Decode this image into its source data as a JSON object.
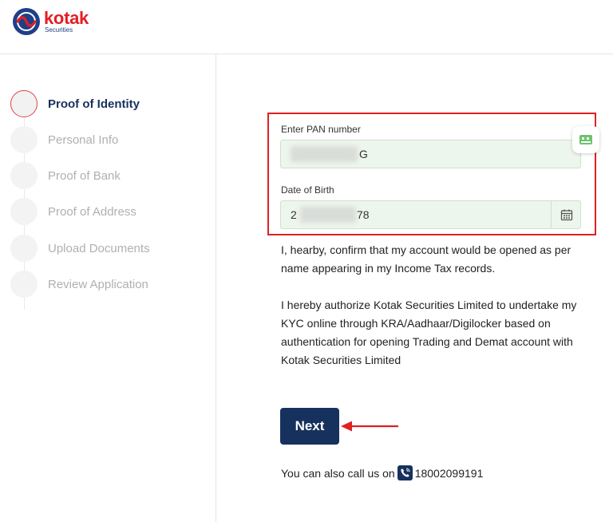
{
  "brand": {
    "name": "kotak",
    "subtitle": "Securities",
    "colors": {
      "red": "#e31e24",
      "navy": "#17315e"
    }
  },
  "steps": [
    {
      "label": "Proof of Identity",
      "active": true
    },
    {
      "label": "Personal Info",
      "active": false
    },
    {
      "label": "Proof of Bank",
      "active": false
    },
    {
      "label": "Proof of Address",
      "active": false
    },
    {
      "label": "Upload Documents",
      "active": false
    },
    {
      "label": "Review Application",
      "active": false
    }
  ],
  "form": {
    "pan": {
      "label": "Enter PAN number",
      "value_visible": "G"
    },
    "dob": {
      "label": "Date of Birth",
      "value_start": "2",
      "value_end": "78"
    }
  },
  "consent": {
    "confirm_text": "I, hearby, confirm that my account would be opened as per name appearing in my Income Tax records.",
    "authorize_text": "I hereby authorize Kotak Securities Limited to undertake my KYC online through KRA/Aadhaar/Digilocker based on authentication for opening Trading and Demat account with Kotak Securities Limited"
  },
  "actions": {
    "next_label": "Next"
  },
  "contact": {
    "prefix": "You can also call us on",
    "phone": "18002099191"
  }
}
